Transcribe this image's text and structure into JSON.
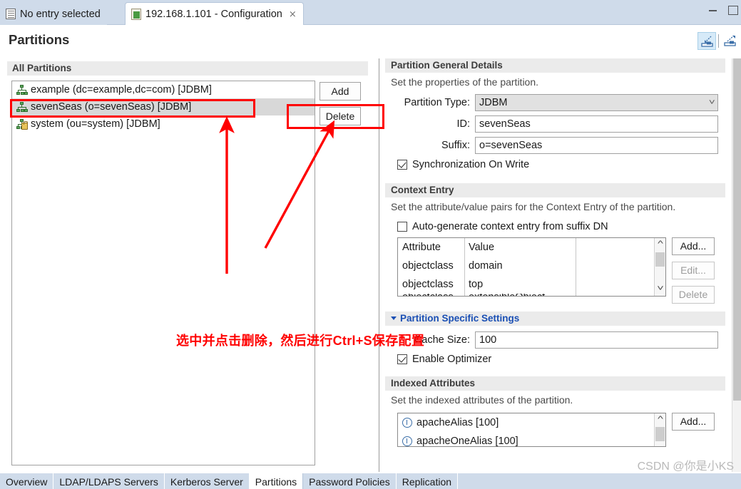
{
  "window": {
    "tabs": [
      {
        "label": "No entry selected",
        "icon": "entry-icon",
        "active": false,
        "closable": false
      },
      {
        "label": "192.168.1.101 - Configuration",
        "icon": "configuration-icon",
        "active": true,
        "closable": true,
        "close_glyph": "⨯"
      }
    ],
    "controls": {
      "minimize": "minimize-button",
      "maximize": "maximize-button"
    }
  },
  "header": {
    "title": "Partitions",
    "tools": [
      {
        "name": "minimize-view-icon",
        "selected": true
      },
      {
        "name": "maximize-view-icon",
        "selected": false
      }
    ]
  },
  "left": {
    "section_label": "All Partitions",
    "partitions": [
      {
        "label": "example (dc=example,dc=com) [JDBM]",
        "icon": "partition-icon",
        "selected": false,
        "locked": false
      },
      {
        "label": "sevenSeas (o=sevenSeas) [JDBM]",
        "icon": "partition-icon",
        "selected": true,
        "locked": false
      },
      {
        "label": "system (ou=system) [JDBM]",
        "icon": "partition-locked-icon",
        "selected": false,
        "locked": true
      }
    ],
    "buttons": {
      "add": "Add",
      "delete": "Delete"
    }
  },
  "right": {
    "general": {
      "title": "Partition General Details",
      "description": "Set the properties of the partition.",
      "partition_type_label": "Partition Type:",
      "partition_type_value": "JDBM",
      "id_label": "ID:",
      "id_value": "sevenSeas",
      "suffix_label": "Suffix:",
      "suffix_value": "o=sevenSeas",
      "sync_on_write_label": "Synchronization On Write",
      "sync_on_write_checked": true
    },
    "context_entry": {
      "title": "Context Entry",
      "description": "Set the attribute/value pairs for the Context Entry of the partition.",
      "autogen_label": "Auto-generate context entry from suffix DN",
      "autogen_checked": false,
      "columns": [
        "Attribute",
        "Value"
      ],
      "rows": [
        [
          "objectclass",
          "domain"
        ],
        [
          "objectclass",
          "top"
        ],
        [
          "objectclass",
          "extensibleObject"
        ]
      ],
      "buttons": [
        {
          "label": "Add...",
          "enabled": true
        },
        {
          "label": "Edit...",
          "enabled": false
        },
        {
          "label": "Delete",
          "enabled": false
        }
      ]
    },
    "specific_settings": {
      "title": "Partition Specific Settings",
      "expanded": true,
      "cache_size_label": "Cache Size:",
      "cache_size_value": "100",
      "enable_optimizer_label": "Enable Optimizer",
      "enable_optimizer_checked": true
    },
    "indexed_attributes": {
      "title": "Indexed Attributes",
      "description": "Set the indexed attributes of the partition.",
      "items": [
        "apacheAlias [100]",
        "apacheOneAlias [100]"
      ],
      "buttons": [
        {
          "label": "Add...",
          "enabled": true
        }
      ]
    }
  },
  "bottom_tabs": [
    {
      "label": "Overview",
      "active": false
    },
    {
      "label": "LDAP/LDAPS Servers",
      "active": false
    },
    {
      "label": "Kerberos Server",
      "active": false
    },
    {
      "label": "Partitions",
      "active": true
    },
    {
      "label": "Password Policies",
      "active": false
    },
    {
      "label": "Replication",
      "active": false
    }
  ],
  "annotations": {
    "text": "选中并点击删除，然后进行Ctrl+S保存配置",
    "color": "#ff0000",
    "boxes": [
      "selected-partition-highlight",
      "delete-button-highlight"
    ],
    "arrows": [
      "arrow-to-selected-partition",
      "arrow-to-delete-button"
    ]
  },
  "watermark": "CSDN @你是小KS"
}
